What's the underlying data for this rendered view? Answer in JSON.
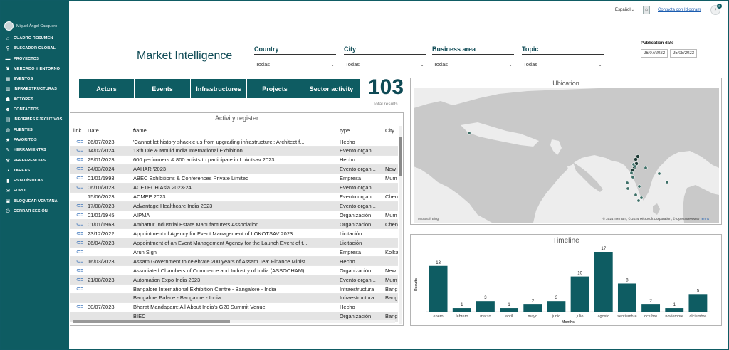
{
  "user": {
    "name": "Miguel Ángel Casquero"
  },
  "sidebar": {
    "items": [
      {
        "label": "CUADRO RESUMEN",
        "icon": "hierarchy-icon",
        "glyph": "⌂"
      },
      {
        "label": "BUSCADOR GLOBAL",
        "icon": "search-icon",
        "glyph": "⚲"
      },
      {
        "label": "PROYECTOS",
        "icon": "folder-icon",
        "glyph": "▬"
      },
      {
        "label": "MERCADO Y ENTORNO",
        "icon": "market-icon",
        "glyph": "♜"
      },
      {
        "label": "EVENTOS",
        "icon": "calendar-icon",
        "glyph": "▦"
      },
      {
        "label": "INFRAESTRUCTURAS",
        "icon": "building-icon",
        "glyph": "▥"
      },
      {
        "label": "ACTORES",
        "icon": "users-icon",
        "glyph": "☗"
      },
      {
        "label": "CONTACTOS",
        "icon": "contact-icon",
        "glyph": "☻"
      },
      {
        "label": "INFORMES EJECUTIVOS",
        "icon": "report-icon",
        "glyph": "▤"
      },
      {
        "label": "FUENTES",
        "icon": "globe-icon",
        "glyph": "◍"
      },
      {
        "label": "FAVORITOS",
        "icon": "star-icon",
        "glyph": "★"
      },
      {
        "label": "HERRAMIENTAS",
        "icon": "tools-icon",
        "glyph": "✎"
      },
      {
        "label": "PREFERENCIAS",
        "icon": "gear-icon",
        "glyph": "✻"
      },
      {
        "label": "TAREAS",
        "icon": "clock-icon",
        "glyph": "◔"
      },
      {
        "label": "ESTADÍSTICAS",
        "icon": "stats-icon",
        "glyph": "▮"
      },
      {
        "label": "FORO",
        "icon": "chat-icon",
        "glyph": "✉"
      },
      {
        "label": "BLOQUEAR VENTANA",
        "icon": "lock-icon",
        "glyph": "▣"
      },
      {
        "label": "CERRAR SESIÓN",
        "icon": "logout-icon",
        "glyph": "⏻"
      }
    ]
  },
  "topbar": {
    "language": "Español",
    "contact_link": "Contacta con Idiogram",
    "notifications_count": "0"
  },
  "main": {
    "title": "Market Intelligence",
    "filters": [
      {
        "label": "Country",
        "value": "Todas"
      },
      {
        "label": "City",
        "value": "Todas"
      },
      {
        "label": "Business area",
        "value": "Todas"
      },
      {
        "label": "Topic",
        "value": "Todas"
      }
    ],
    "publication_date": {
      "label": "Publication date",
      "from": "26/07/2022",
      "to": "25/08/2023"
    },
    "tabs": [
      "Actors",
      "Events",
      "Infrastructures",
      "Projects",
      "Sector activity"
    ],
    "kpi": {
      "value": "103",
      "label": "Total results"
    }
  },
  "activity": {
    "title": "Activity register",
    "columns": {
      "link": "link",
      "date": "Date",
      "name": "name",
      "type": "type",
      "city": "City"
    },
    "rows": [
      {
        "link": true,
        "date": "26/07/2023",
        "name": "'Cannot let history shackle us from upgrading infrastructure': Architect f...",
        "type": "Hecho",
        "city": ""
      },
      {
        "link": true,
        "date": "14/02/2024",
        "name": "13th Die & Mould India International Exhibition",
        "type": "Evento organ...",
        "city": ""
      },
      {
        "link": true,
        "date": "29/01/2023",
        "name": "600 performers & 800 artists to participate in Lokotsav 2023",
        "type": "Hecho",
        "city": ""
      },
      {
        "link": true,
        "date": "24/03/2024",
        "name": "AAHAR '2023",
        "type": "Evento organ...",
        "city": "New"
      },
      {
        "link": true,
        "date": "01/01/1993",
        "name": "ABEC Exhibitions & Conferences Private Limited",
        "type": "Empresa",
        "city": "Mum"
      },
      {
        "link": true,
        "date": "06/10/2023",
        "name": "ACETECH Asia 2023-24",
        "type": "Evento organ...",
        "city": ""
      },
      {
        "link": false,
        "date": "15/06/2023",
        "name": "ACMEE 2023",
        "type": "Evento organ...",
        "city": "Chen"
      },
      {
        "link": true,
        "date": "17/08/2023",
        "name": "Advantage Healthcare India 2023",
        "type": "Evento organ...",
        "city": ""
      },
      {
        "link": true,
        "date": "01/01/1945",
        "name": "AIPMA",
        "type": "Organización",
        "city": "Mum"
      },
      {
        "link": true,
        "date": "01/01/1963",
        "name": "Ambattur Industrial Estate Manufacturers Association",
        "type": "Organización",
        "city": "Chen"
      },
      {
        "link": true,
        "date": "23/12/2022",
        "name": "Appointment of Agency for Event Management of LOKOTSAV 2023",
        "type": "Licitación",
        "city": ""
      },
      {
        "link": true,
        "date": "26/04/2023",
        "name": "Appointment of an Event Management Agency for the Launch Event of t...",
        "type": "Licitación",
        "city": ""
      },
      {
        "link": true,
        "date": "",
        "name": "Arun Sign",
        "type": "Empresa",
        "city": "Kolka"
      },
      {
        "link": true,
        "date": "16/03/2023",
        "name": "Assam Government to celebrate 200 years of Assam Tea: Finance Minist...",
        "type": "Hecho",
        "city": ""
      },
      {
        "link": true,
        "date": "",
        "name": "Associated Chambers of Commerce and Industry of India (ASSOCHAM)",
        "type": "Organización",
        "city": "New"
      },
      {
        "link": true,
        "date": "21/08/2023",
        "name": "Automation Expo India 2023",
        "type": "Evento organ...",
        "city": "Mum"
      },
      {
        "link": true,
        "date": "",
        "name": "Bangalore International Exhibition Centre - Bangalore - India",
        "type": "Infraestructura",
        "city": "Bang"
      },
      {
        "link": false,
        "date": "",
        "name": "Bangalore Palace - Bangalore - India",
        "type": "Infraestructura",
        "city": "Bang"
      },
      {
        "link": true,
        "date": "30/07/2023",
        "name": "Bharat Mandapam: All About India's G20 Summit Venue",
        "type": "Hecho",
        "city": ""
      },
      {
        "link": false,
        "date": "",
        "name": "BIEC",
        "type": "Organización",
        "city": "Bang"
      }
    ]
  },
  "map": {
    "title": "Ubication",
    "attribution": "© 2024 TomTom, © 2024 Microsoft Corporation, © OpenStreetMap",
    "terms": "Terms",
    "brand": "Microsoft Bing",
    "land_color": "#c9c9c9",
    "water_color": "#ededed",
    "marker_color": "#3d6f67"
  },
  "timeline": {
    "title": "Timeline",
    "xlabel": "Months",
    "ylabel": "Results"
  },
  "chart_data": {
    "type": "bar",
    "title": "Timeline",
    "xlabel": "Months",
    "ylabel": "Results",
    "categories": [
      "enero",
      "febrero",
      "marzo",
      "abril",
      "mayo",
      "junio",
      "julio",
      "agosto",
      "septiembre",
      "octubre",
      "noviembre",
      "diciembre"
    ],
    "values": [
      13,
      1,
      3,
      1,
      2,
      3,
      10,
      17,
      8,
      2,
      1,
      5
    ],
    "bar_color": "#0e5c62",
    "data_labels": true,
    "grid": false
  }
}
